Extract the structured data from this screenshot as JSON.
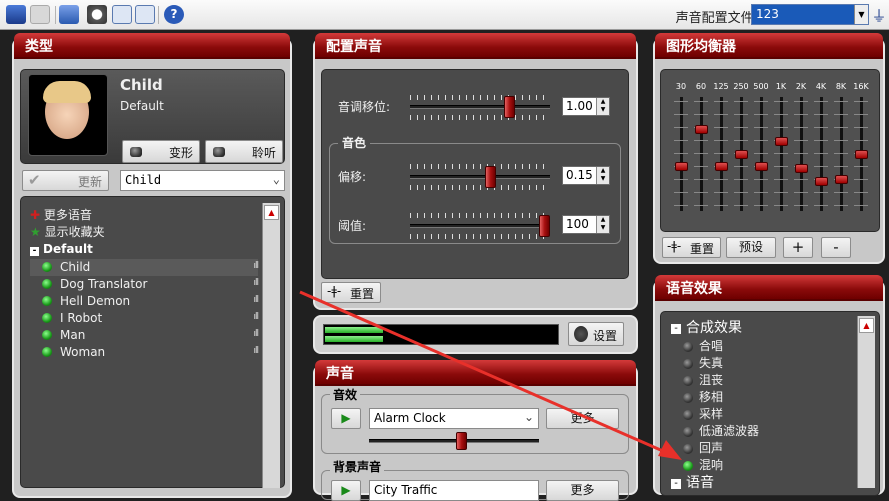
{
  "toolbar": {
    "profile_label": "声音配置文件:",
    "profile_value": "123",
    "icons": [
      "save-icon",
      "keyboard-icon",
      "plug-icon",
      "clock-icon",
      "waveform-icon",
      "image-icon",
      "help-icon",
      "filter-icon"
    ]
  },
  "type_panel": {
    "title": "类型",
    "voice_name": "Child",
    "voice_sub": "Default",
    "morph_btn": "变形",
    "listen_btn": "聆听",
    "update_btn": "更新",
    "voice_select": "Child",
    "more_voices": "更多语音",
    "show_favorites": "显示收藏夹",
    "group": "Default",
    "voices": [
      "Child",
      "Dog Translator",
      "Hell Demon",
      "I Robot",
      "Man",
      "Woman"
    ]
  },
  "config_panel": {
    "title": "配置声音",
    "pitch_label": "音调移位:",
    "pitch_value": "1.00",
    "pitch_level": 0.73,
    "timbre_label": "音色",
    "offset_label": "偏移:",
    "offset_value": "0.15",
    "offset_level": 0.58,
    "threshold_label": "阈值:",
    "threshold_value": "100",
    "threshold_level": 1.0,
    "reset_btn": "重置"
  },
  "meter": {
    "settings_btn": "设置",
    "level": 0.25
  },
  "sound_panel": {
    "title": "声音",
    "effects_label": "音效",
    "effect_select": "Alarm Clock",
    "more_btn": "更多",
    "bg_label": "背景声音",
    "bg_select": "City Traffic",
    "bg_more_btn": "更多",
    "effect_volume": 0.55
  },
  "eq_panel": {
    "title": "图形均衡器",
    "bands": [
      "30",
      "60",
      "125",
      "250",
      "500",
      "1K",
      "2K",
      "4K",
      "8K",
      "16K"
    ],
    "levels": [
      0.62,
      0.27,
      0.62,
      0.5,
      0.62,
      0.38,
      0.64,
      0.76,
      0.74,
      0.5
    ],
    "reset_btn": "重置",
    "preset_btn": "预设",
    "plus_btn": "+",
    "minus_btn": "-"
  },
  "effects_panel": {
    "title": "语音效果",
    "group1": "合成效果",
    "items": [
      {
        "label": "合唱",
        "on": false
      },
      {
        "label": "失真",
        "on": false
      },
      {
        "label": "沮丧",
        "on": false
      },
      {
        "label": "移相",
        "on": false
      },
      {
        "label": "采样",
        "on": false
      },
      {
        "label": "低通滤波器",
        "on": false
      },
      {
        "label": "回声",
        "on": false
      },
      {
        "label": "混响",
        "on": true
      }
    ],
    "group2": "语音"
  }
}
